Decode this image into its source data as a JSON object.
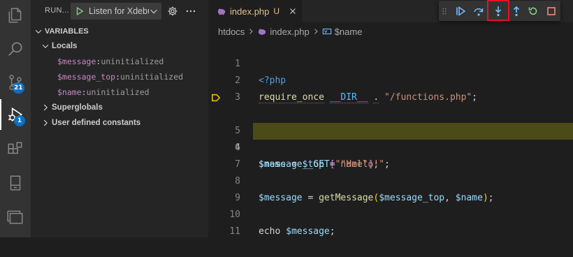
{
  "activity_bar": {
    "source_control_badge": "21",
    "debug_badge": "1"
  },
  "sidebar": {
    "title": "RUN...",
    "launch_config": "Listen for Xdebug",
    "variables_header": "VARIABLES",
    "scopes": {
      "locals": {
        "label": "Locals",
        "vars": [
          {
            "name": "$message",
            "value": "uninitialized"
          },
          {
            "name": "$message_top",
            "value": "uninitialized"
          },
          {
            "name": "$name",
            "value": "uninitialized"
          }
        ]
      },
      "superglobals": {
        "label": "Superglobals"
      },
      "user_constants": {
        "label": "User defined constants"
      }
    }
  },
  "editor": {
    "tab": {
      "label": "index.php",
      "status": "U"
    },
    "breadcrumb": {
      "folder": "htdocs",
      "file": "index.php",
      "symbol": "$name"
    },
    "current_line": 4,
    "line_numbers": [
      "1",
      "2",
      "3",
      "4",
      "5",
      "6",
      "7",
      "8",
      "9",
      "10",
      "11"
    ],
    "code": {
      "l1": "<?php",
      "l2_fn": "require_once",
      "l2_const": "__DIR__",
      "l2_dot": ".",
      "l2_str": "\"/functions.php\"",
      "l2_end": ";",
      "l4_var": "$name",
      "l4_op": "=",
      "l4_get": "$_GET",
      "l4_key": "\"name\"",
      "l6_var": "$message_top",
      "l6_op": "=",
      "l6_str": "\"Hello!\"",
      "l8_var": "$message",
      "l8_op": "=",
      "l8_fn": "getMessage",
      "l8_a1": "$message_top",
      "l8_comma": ",",
      "l8_a2": "$name",
      "l10_kw": "echo",
      "l10_var": "$message"
    }
  },
  "colors": {
    "accent_blue": "#75beff",
    "highlight_border": "#e81123",
    "current_line_bg": "#4b4b18",
    "debug_arrow": "#ffcc00",
    "restart_green": "#89d185",
    "stop_red": "#f48771"
  },
  "icons": [
    "explorer-icon",
    "search-icon",
    "source-control-icon",
    "run-debug-icon",
    "extensions-icon",
    "remote-explorer-icon",
    "panels-icon",
    "play-icon",
    "gear-icon",
    "more-icon",
    "continue-icon",
    "step-over-icon",
    "step-into-icon",
    "step-out-icon",
    "restart-icon",
    "stop-icon",
    "gripper-icon",
    "close-icon",
    "php-file-icon",
    "symbol-variable-icon",
    "chevron-down-icon",
    "chevron-right-icon"
  ]
}
